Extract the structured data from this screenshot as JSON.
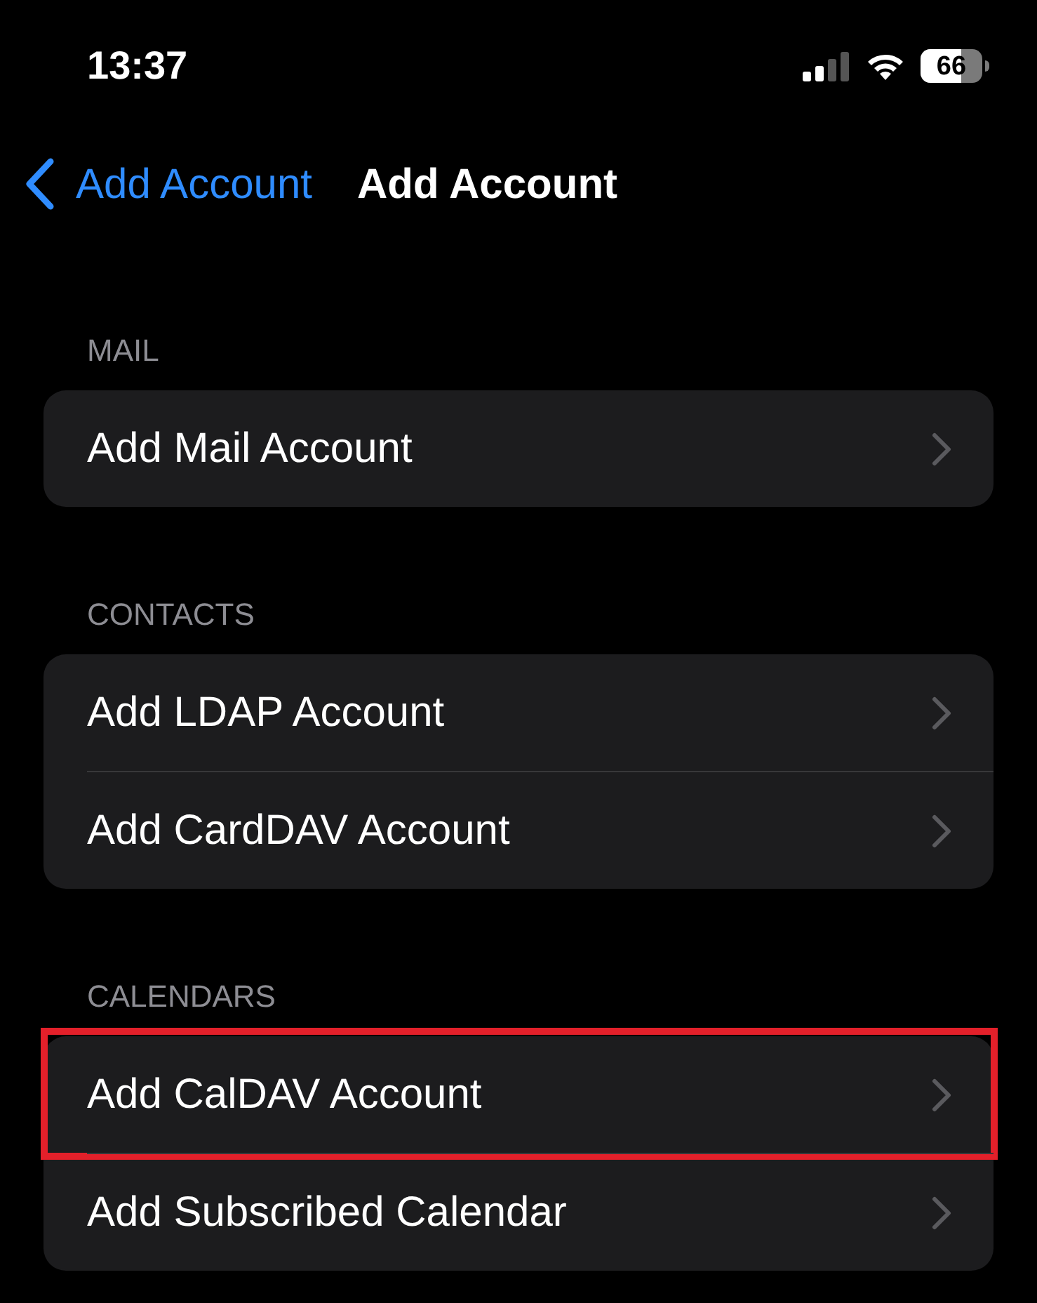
{
  "status_bar": {
    "time": "13:37",
    "battery": "66"
  },
  "nav": {
    "back_label": "Add Account",
    "title": "Add Account"
  },
  "sections": [
    {
      "header": "MAIL",
      "items": [
        {
          "label": "Add Mail Account",
          "highlighted": false
        }
      ]
    },
    {
      "header": "CONTACTS",
      "items": [
        {
          "label": "Add LDAP Account",
          "highlighted": false
        },
        {
          "label": "Add CardDAV Account",
          "highlighted": false
        }
      ]
    },
    {
      "header": "CALENDARS",
      "items": [
        {
          "label": "Add CalDAV Account",
          "highlighted": true
        },
        {
          "label": "Add Subscribed Calendar",
          "highlighted": false
        }
      ]
    }
  ]
}
